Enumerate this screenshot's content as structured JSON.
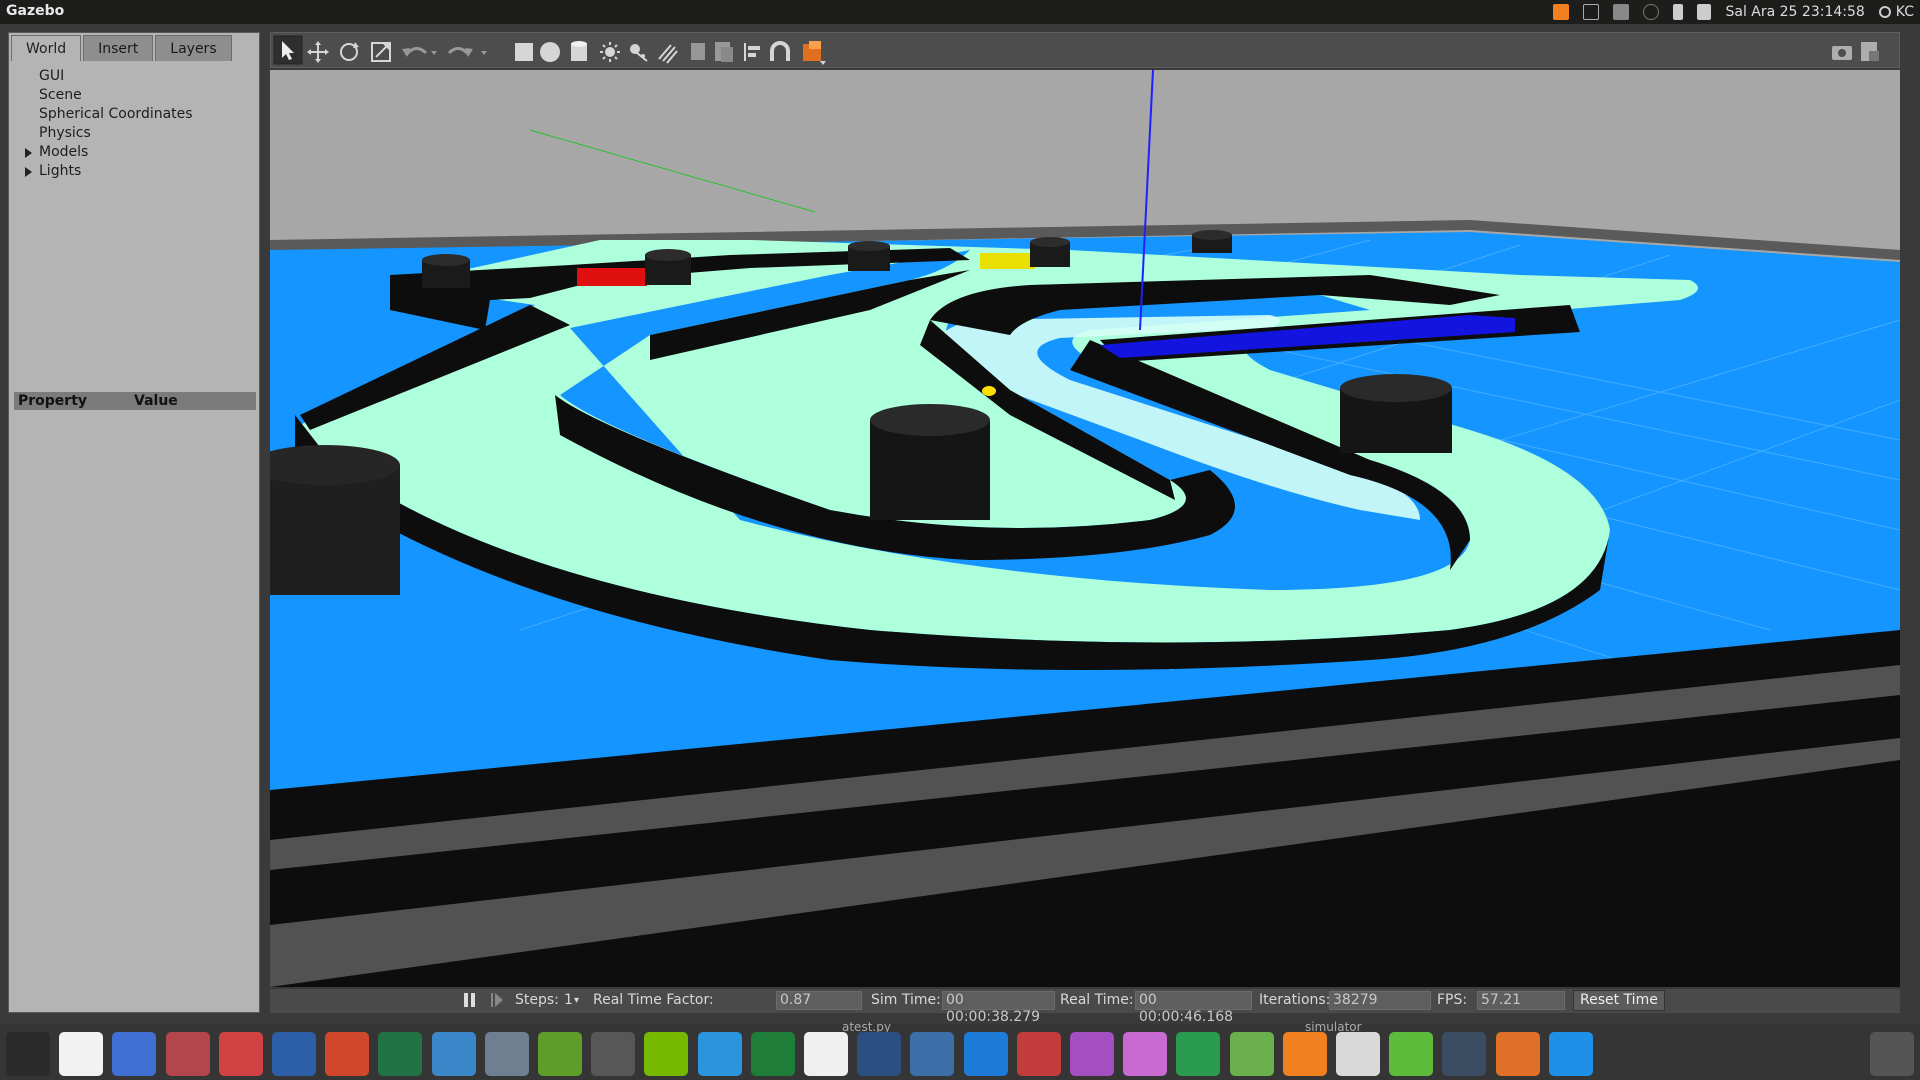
{
  "topbar": {
    "app_title": "Gazebo",
    "clock": "Sal Ara 25 23:14:58",
    "user": "KC"
  },
  "left_panel": {
    "tabs": [
      "World",
      "Insert",
      "Layers"
    ],
    "tree": [
      {
        "label": "GUI",
        "expandable": false
      },
      {
        "label": "Scene",
        "expandable": false
      },
      {
        "label": "Spherical Coordinates",
        "expandable": false
      },
      {
        "label": "Physics",
        "expandable": false
      },
      {
        "label": "Models",
        "expandable": true
      },
      {
        "label": "Lights",
        "expandable": true
      }
    ],
    "property_header": {
      "property": "Property",
      "value": "Value"
    }
  },
  "toolbar": {
    "icons": [
      "select-icon",
      "translate-icon",
      "rotate-icon",
      "scale-icon",
      "undo-icon",
      "redo-icon",
      "box-icon",
      "sphere-icon",
      "cylinder-icon",
      "point-light-icon",
      "spot-light-icon",
      "directional-light-icon",
      "copy-icon",
      "paste-icon",
      "align-icon",
      "snap-icon",
      "view-angle-icon",
      "screenshot-icon",
      "log-icon"
    ]
  },
  "statusbar": {
    "steps_label": "Steps:",
    "steps_value": "1",
    "rtf_label": "Real Time Factor:",
    "rtf_value": "0.87",
    "sim_label": "Sim Time:",
    "sim_value": "00 00:00:38.279",
    "real_label": "Real Time:",
    "real_value": "00 00:00:46.168",
    "iter_label": "Iterations:",
    "iter_value": "38279",
    "fps_label": "FPS:",
    "fps_value": "57.21",
    "reset_label": "Reset Time"
  },
  "taskbar": {
    "notes": [
      "atest.py",
      "simulator"
    ],
    "apps": [
      {
        "name": "ubuntu-dash-icon",
        "color": "#2b2b2b"
      },
      {
        "name": "power-icon",
        "color": "#f2f2f2"
      },
      {
        "name": "chromium-icon",
        "color": "#3f6fd2"
      },
      {
        "name": "files-icon",
        "color": "#b3464c"
      },
      {
        "name": "pdf-editor-icon",
        "color": "#d24242"
      },
      {
        "name": "word-icon",
        "color": "#2d5fa8"
      },
      {
        "name": "powerpoint-icon",
        "color": "#d0472b"
      },
      {
        "name": "excel-icon",
        "color": "#217346"
      },
      {
        "name": "software-center-icon",
        "color": "#3a88c9"
      },
      {
        "name": "disk-icon",
        "color": "#6e7f92"
      },
      {
        "name": "terminal-green-icon",
        "color": "#5f9d2b"
      },
      {
        "name": "camera-icon",
        "color": "#575757"
      },
      {
        "name": "nvidia-icon",
        "color": "#76b900"
      },
      {
        "name": "download-icon",
        "color": "#2a94dd"
      },
      {
        "name": "system-monitor-icon",
        "color": "#1f7d3a"
      },
      {
        "name": "paint-icon",
        "color": "#f0f0f0"
      },
      {
        "name": "video-icon",
        "color": "#2a4f80"
      },
      {
        "name": "settings-toggle-icon",
        "color": "#3c6fa7"
      },
      {
        "name": "window-manager-icon",
        "color": "#1f7bd8"
      },
      {
        "name": "toggle-panel-icon",
        "color": "#c33c3c"
      },
      {
        "name": "webcam-icon",
        "color": "#a34ec1"
      },
      {
        "name": "media-player-icon",
        "color": "#c96ad2"
      },
      {
        "name": "calculator-icon",
        "color": "#2b9b4f"
      },
      {
        "name": "android-studio-icon",
        "color": "#6ab04c"
      },
      {
        "name": "vlc-icon",
        "color": "#f08020"
      },
      {
        "name": "calendar-icon",
        "color": "#d9d9d9"
      },
      {
        "name": "phone-icon",
        "color": "#5dbb3b"
      },
      {
        "name": "terminal-icon",
        "color": "#3b4d63"
      },
      {
        "name": "gazebo-icon",
        "color": "#e07028"
      },
      {
        "name": "folder-blue-icon",
        "color": "#1e90e8"
      },
      {
        "name": "trash-icon",
        "color": "#555555"
      }
    ]
  },
  "colors": {
    "floor_blue": "#1495ff",
    "track_mint": "#aeffdc",
    "wall_black": "#0d0d0d",
    "sky_gray": "#a7a7a7",
    "marker_red": "#e01010",
    "marker_yellow": "#e8e000",
    "marker_blue": "#1414e0",
    "ball_yellow": "#ffe000"
  }
}
